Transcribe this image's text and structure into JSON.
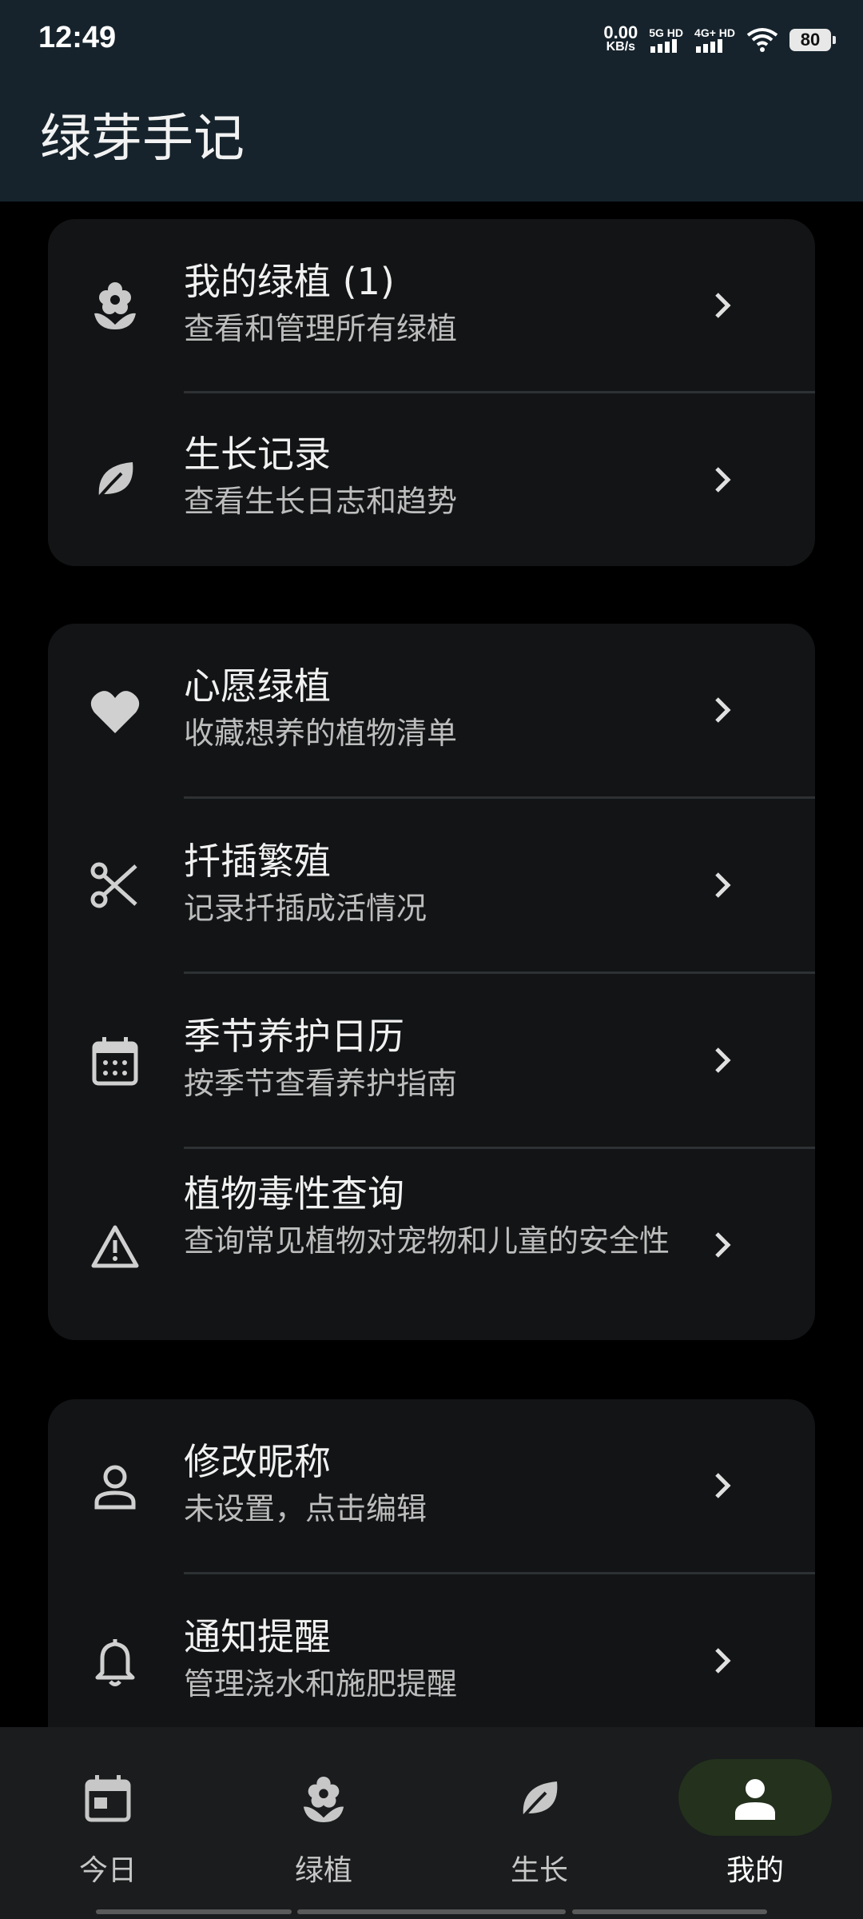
{
  "status_bar": {
    "time": "12:49",
    "net_speed_value": "0.00",
    "net_speed_unit": "KB/s",
    "sim1_label": "5G HD",
    "sim2_label": "4G+ HD",
    "battery": "80"
  },
  "app": {
    "title": "绿芽手记"
  },
  "cards": [
    {
      "rows": [
        {
          "icon": "flower-icon",
          "title": "我的绿植 (1)",
          "subtitle": "查看和管理所有绿植"
        },
        {
          "icon": "leaf-icon",
          "title": "生长记录",
          "subtitle": "查看生长日志和趋势"
        }
      ]
    },
    {
      "rows": [
        {
          "icon": "heart-icon",
          "title": "心愿绿植",
          "subtitle": "收藏想养的植物清单"
        },
        {
          "icon": "scissors-icon",
          "title": "扦插繁殖",
          "subtitle": "记录扦插成活情况"
        },
        {
          "icon": "calendar-icon",
          "title": "季节养护日历",
          "subtitle": "按季节查看养护指南"
        },
        {
          "icon": "warning-icon",
          "title": "植物毒性查询",
          "subtitle": "查询常见植物对宠物和儿童的安全性"
        }
      ]
    },
    {
      "rows": [
        {
          "icon": "person-icon",
          "title": "修改昵称",
          "subtitle": "未设置，点击编辑"
        },
        {
          "icon": "bell-icon",
          "title": "通知提醒",
          "subtitle": "管理浇水和施肥提醒"
        }
      ]
    }
  ],
  "bottom_nav": {
    "items": [
      {
        "icon": "calendar-today-icon",
        "label": "今日"
      },
      {
        "icon": "flower-icon",
        "label": "绿植"
      },
      {
        "icon": "leaf-icon",
        "label": "生长"
      },
      {
        "icon": "person-icon",
        "label": "我的",
        "active": true
      }
    ]
  },
  "colors": {
    "header_bg": "#16232c",
    "card_bg": "#121415",
    "active_pill": "#23311d"
  }
}
